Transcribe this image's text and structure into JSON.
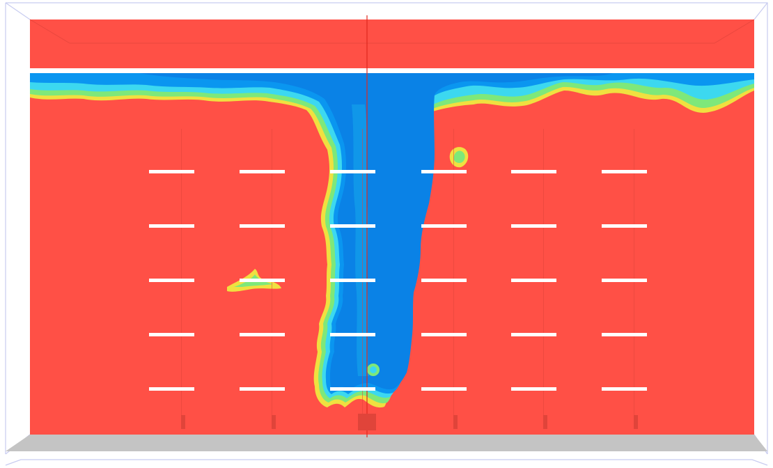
{
  "colors": {
    "background": "#ffffff",
    "hot": "#ff5046",
    "warm_edge": "#ff8a3c",
    "yellow": "#f0e040",
    "green": "#7ee87a",
    "cyan": "#3cd8f0",
    "cyan_mid": "#1ec0ee",
    "blue": "#0a96f0",
    "deep_blue": "#0a82e6",
    "plate": "#ffffff",
    "floor": "#c4c4c4",
    "bounding_box": "#c8ccf0",
    "center_line": "#e0281e"
  },
  "scene": {
    "plate_rows": 5,
    "plate_columns": 6
  }
}
